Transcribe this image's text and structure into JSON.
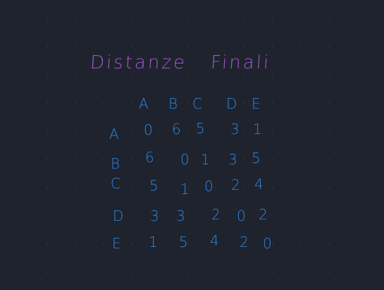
{
  "title": [
    "Distanze",
    "Finali"
  ],
  "columns": [
    "A",
    "B",
    "C",
    "D",
    "E"
  ],
  "rows": [
    {
      "label": "A",
      "values": [
        "0",
        "6",
        "5",
        "3",
        "1"
      ]
    },
    {
      "label": "B",
      "values": [
        "6",
        "0",
        "1",
        "3",
        "5"
      ]
    },
    {
      "label": "C",
      "values": [
        "5",
        "1",
        "0",
        "2",
        "4"
      ]
    },
    {
      "label": "D",
      "values": [
        "3",
        "3",
        "2",
        "0",
        "2"
      ]
    },
    {
      "label": "E",
      "values": [
        "1",
        "5",
        "4",
        "2",
        "0"
      ]
    }
  ],
  "colors": {
    "background": "#1f232d",
    "title": "#9b57c9",
    "matrix": "#2d86e0"
  }
}
